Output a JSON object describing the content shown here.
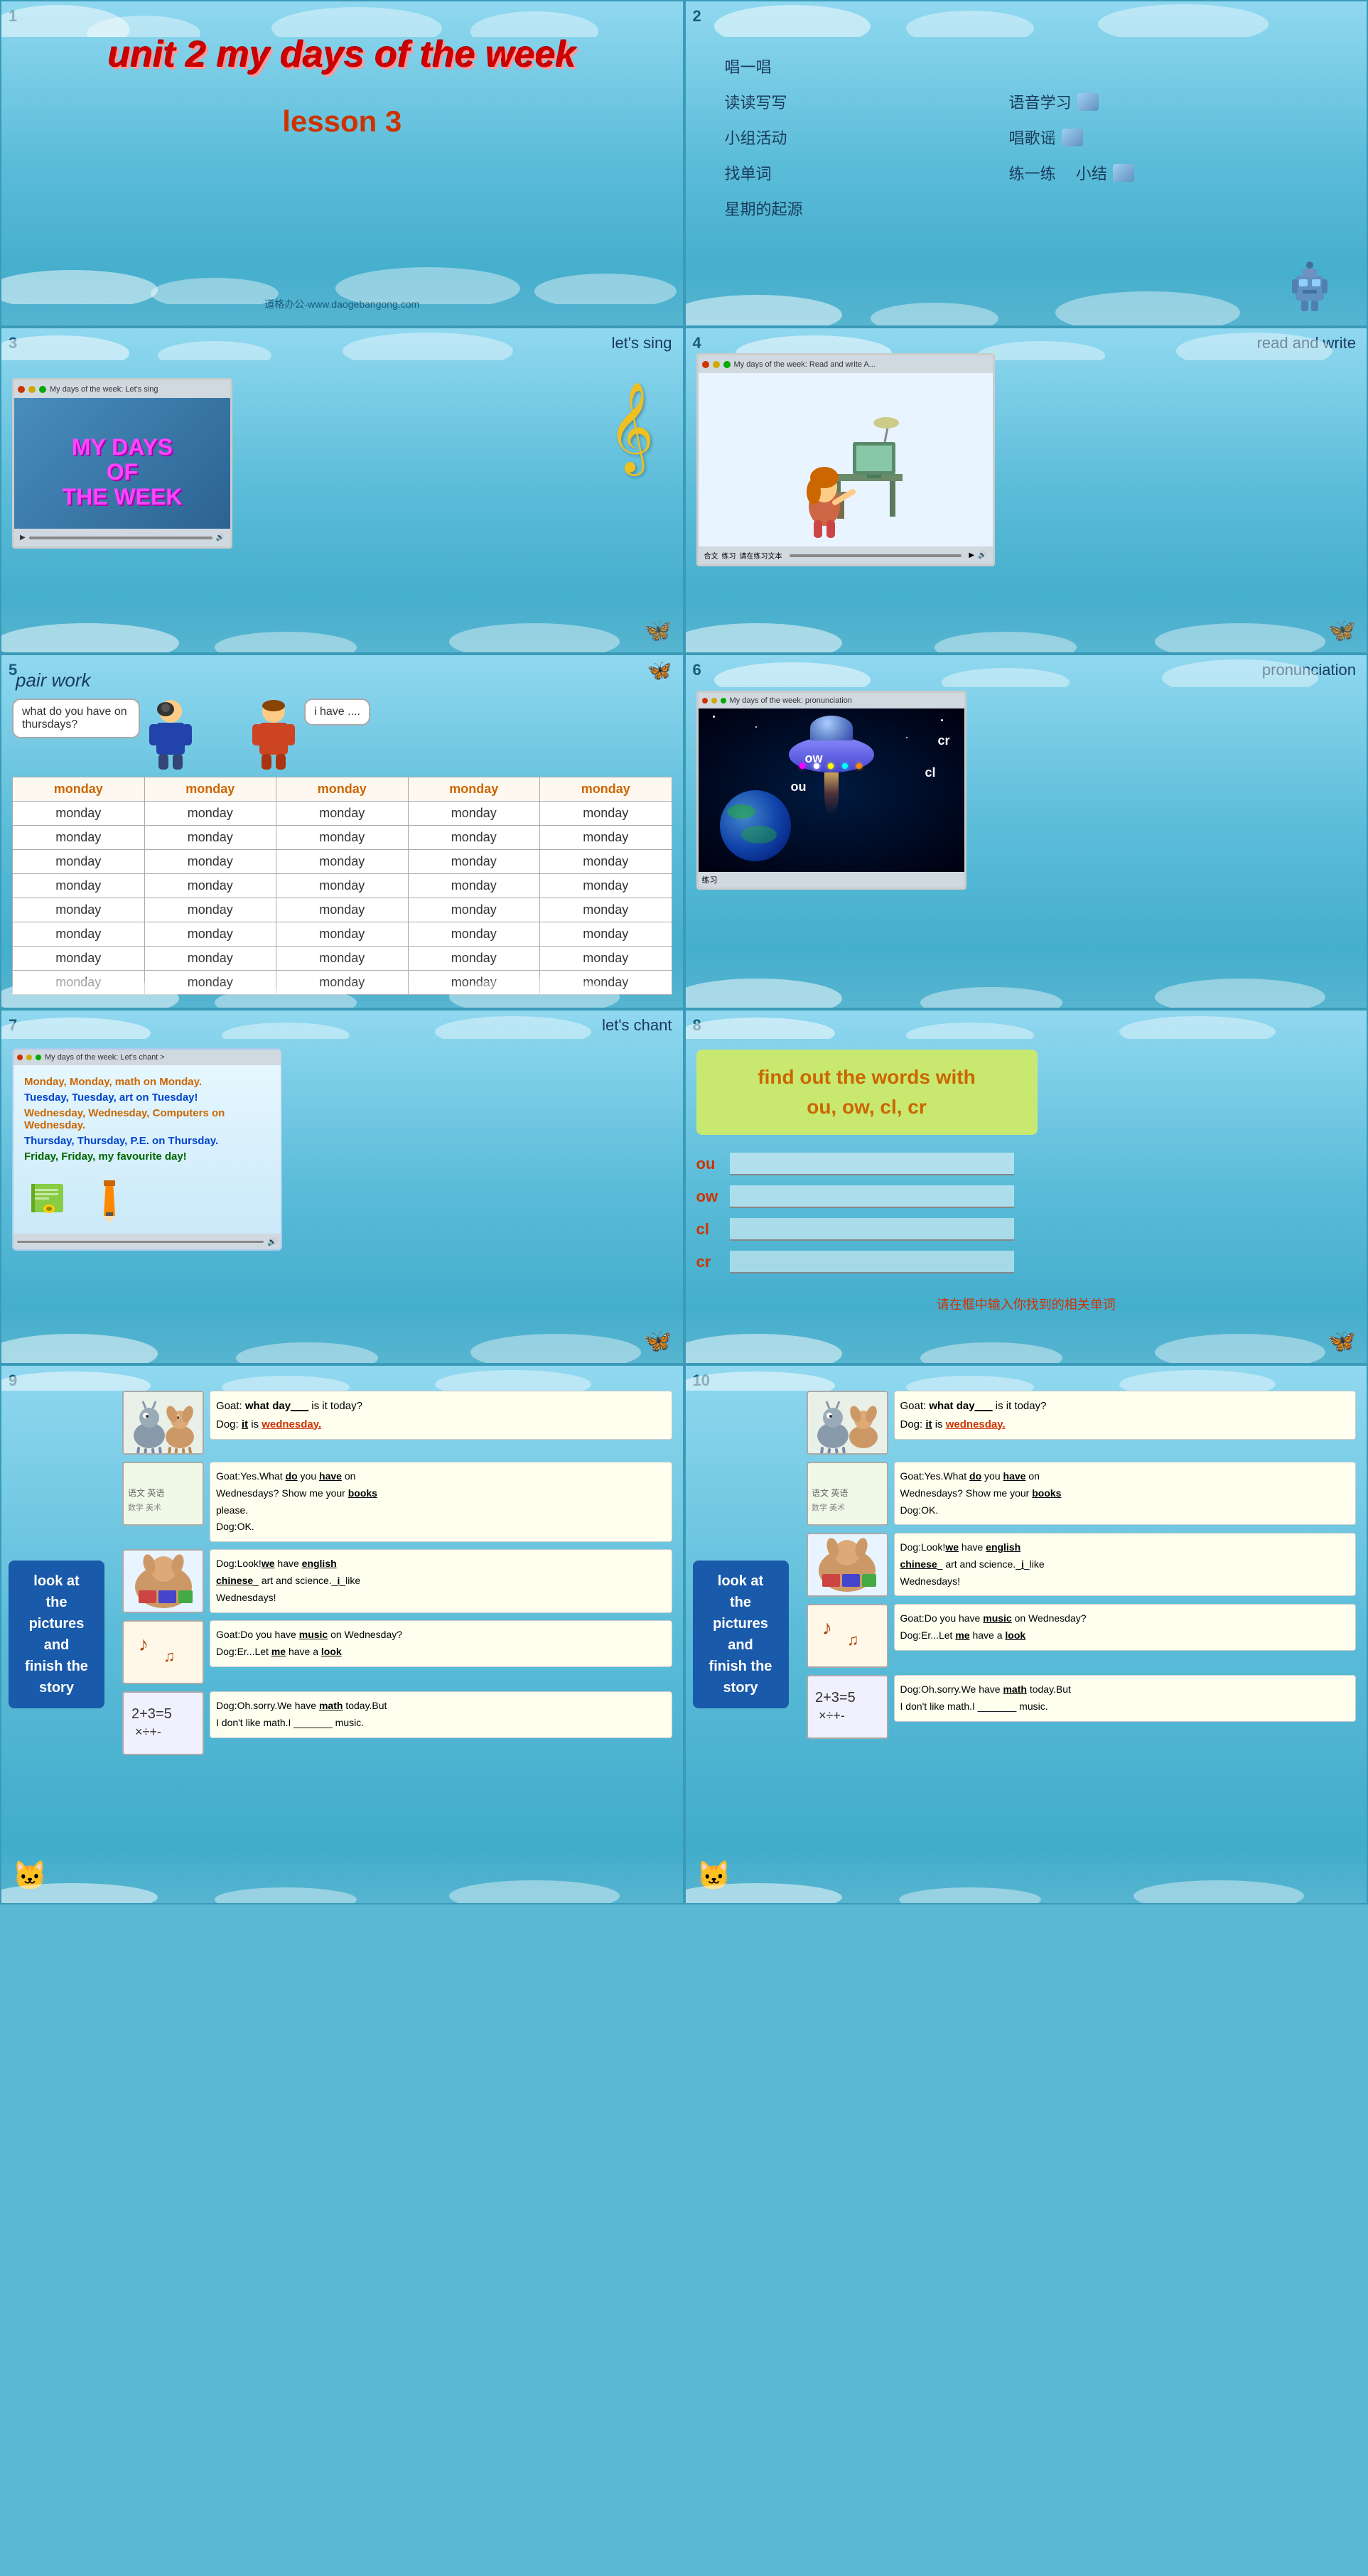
{
  "cells": [
    {
      "num": "1",
      "title_main": "unit 2 my days of the week",
      "title_sub": "lesson 3",
      "watermark": "道格办公-www.daogebangong.com"
    },
    {
      "num": "2",
      "menu": [
        {
          "label": "唱一唱",
          "full": true
        },
        {
          "label": "读读写写",
          "second": "语音学习",
          "has_icon": true
        },
        {
          "label": "小组活动",
          "second": "唱歌谣",
          "has_icon": true
        },
        {
          "label": "找单词",
          "second": "练一练",
          "third": "小结",
          "has_icon": true
        },
        {
          "label": "星期的起源",
          "full": true
        }
      ]
    },
    {
      "num": "3",
      "section": "let's sing",
      "video_title": "My days of the week: Let's sing",
      "video_text": "MY DAYS\nOF\nTHE WEEK"
    },
    {
      "num": "4",
      "section": "read and write"
    },
    {
      "num": "5",
      "section": "pair work",
      "speech1": "what do you have on thursdays?",
      "speech2": "i have ....",
      "table_header": [
        "monday",
        "monday",
        "monday",
        "monday",
        "monday"
      ],
      "table_rows": [
        [
          "monday",
          "monday",
          "monday",
          "monday",
          "monday"
        ],
        [
          "monday",
          "monday",
          "monday",
          "monday",
          "monday"
        ],
        [
          "monday",
          "monday",
          "monday",
          "monday",
          "monday"
        ],
        [
          "monday",
          "monday",
          "monday",
          "monday",
          "monday"
        ],
        [
          "monday",
          "monday",
          "monday",
          "monday",
          "monday"
        ],
        [
          "monday",
          "monday",
          "monday",
          "monday",
          "monday"
        ],
        [
          "monday",
          "monday",
          "monday",
          "monday",
          "monday"
        ],
        [
          "monday",
          "monday",
          "monday",
          "monday",
          "monday"
        ]
      ]
    },
    {
      "num": "6",
      "section": "pronunciation",
      "video_title": "My days of the week: pronunciation",
      "phonics": [
        "ow",
        "cr",
        "cl",
        "ou"
      ]
    },
    {
      "num": "7",
      "section": "let's chant",
      "chant_lines": [
        "Monday, Monday, math on Monday.",
        "Tuesday, Tuesday, art on Tuesday!",
        "Wednesday, Wednesday, Computers on Wednesday.",
        "Thursday, Thursday, P.E. on Thursday.",
        "Friday, Friday, my favourite day!"
      ]
    },
    {
      "num": "8",
      "find_title1": "find out the words with",
      "find_title2": "ou, ow, cl, cr",
      "labels": [
        "ou",
        "ow",
        "cl",
        "cr"
      ],
      "hint": "请在框中输入你找到的相关单词"
    },
    {
      "num": "9",
      "look_at": "look at\nthe\npictures\nand\nfinish the\nstory",
      "panels": [
        {
          "goat_text": "Goat: ",
          "dialogue": "what day___ is it today?\nDog: __it__ is wednesday."
        },
        {
          "dialogue": "Goat:Yes.What __do__ you __have__ on Wednesdays? Show me your __books__ please.\nDog:OK."
        },
        {
          "dog_text": "Dog:Look!__we__have __english__\nchinese__ art and science.__i__like\nWednesdays!"
        },
        {
          "dialogue": "Goat:Do you have __music__ on Wednesday?\nDog:Er...Let __me__ have a __look__"
        },
        {
          "dialogue": "Dog:Oh.sorry.We have __math__ today.But I don't like math.I _______ music."
        }
      ]
    },
    {
      "num": "10",
      "look_at": "look at\nthe\npictures\nand\nfinish the\nstory",
      "panels": [
        {
          "dialogue": "Goat: what day___ is it today?\nDog: __it__ is wednesday."
        },
        {
          "dialogue": "Goat:Yes.What __do__ you __have__ on Wednesdays? Show me your __books__\nDog:OK."
        },
        {
          "dog_text": "Dog:Look!__we__ have __english__\nchinese__ art and science.__i__like\nWednesdays!"
        },
        {
          "dialogue": "Goat:Do you have __music__ on Wednesday?\nDog:Er...Let __me__ have a __look__"
        },
        {
          "dialogue": "Dog:Oh.sorry.We have __math__ today.But I don't like math.I _______ music."
        }
      ]
    }
  ]
}
